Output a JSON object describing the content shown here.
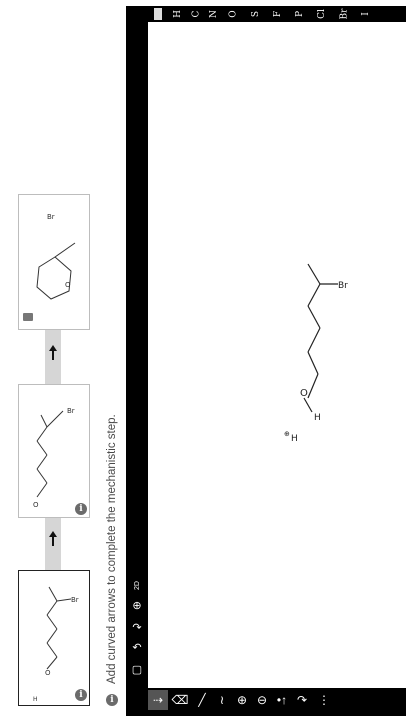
{
  "instructions": {
    "text": "Add curved arrows to complete the mechanistic step.",
    "info_icon": "info-icon"
  },
  "panels": [
    {
      "id": "step-1",
      "state": "active",
      "labels": {
        "h": "H",
        "charge": "⊕",
        "o": "O",
        "br": "Br"
      }
    },
    {
      "id": "step-2",
      "state": "inactive",
      "labels": {
        "o": "O",
        "charge": "⊕",
        "br": "Br"
      }
    },
    {
      "id": "step-3",
      "state": "locked",
      "labels": {
        "o": "O",
        "br": "Br",
        "charge": "⊖"
      }
    }
  ],
  "canvas_labels": {
    "o": "O",
    "h_on_o": "H",
    "br": "Br",
    "h_ion": "H",
    "h_ion_charge": "⊕"
  },
  "toolbar": {
    "elements": [
      "H",
      "C",
      "N",
      "O",
      "S",
      "F",
      "P",
      "Cl",
      "Br",
      "I"
    ],
    "tools": [
      "select-icon",
      "eraser-icon",
      "bond-icon",
      "chain-icon",
      "plus-charge-icon",
      "minus-charge-icon",
      "lone-pair-icon",
      "curved-arrow-icon",
      "more-icon"
    ],
    "left_tools": [
      "undo-icon",
      "redo-icon",
      "zoom-icon",
      "fit-icon",
      "help-icon"
    ],
    "zoom_label": "2D"
  },
  "colors": {
    "frame": "#000000",
    "connector": "#d6d6d6",
    "text": "#4a4a4a"
  }
}
